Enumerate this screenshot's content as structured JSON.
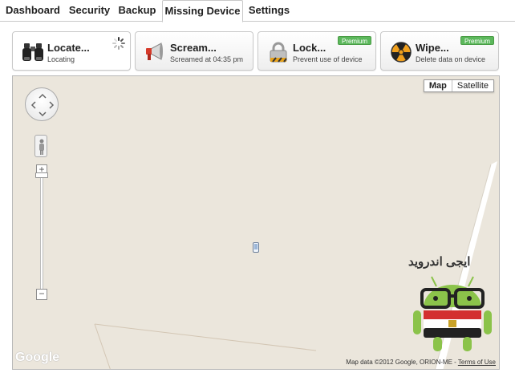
{
  "tabs": [
    {
      "label": "Dashboard",
      "active": false
    },
    {
      "label": "Security",
      "active": false
    },
    {
      "label": "Backup",
      "active": false
    },
    {
      "label": "Missing Device",
      "active": true
    },
    {
      "label": "Settings",
      "active": false
    }
  ],
  "actions": [
    {
      "title": "Locate...",
      "subtitle": "Locating",
      "icon": "binoculars-icon",
      "status": "loading-spinner"
    },
    {
      "title": "Scream...",
      "subtitle": "Screamed at 04:35 pm",
      "icon": "megaphone-icon"
    },
    {
      "title": "Lock...",
      "subtitle": "Prevent use of device",
      "icon": "padlock-icon",
      "badge": "Premium"
    },
    {
      "title": "Wipe...",
      "subtitle": "Delete data on device",
      "icon": "radiation-icon",
      "badge": "Premium"
    }
  ],
  "map": {
    "types": [
      "Map",
      "Satellite"
    ],
    "selected_type": "Map",
    "zoom_in": "+",
    "zoom_out": "−",
    "logo": "Google",
    "attribution": "Map data ©2012 Google, ORION-ME - ",
    "terms_link": "Terms of Use",
    "watermark_text": "ايجى اندرويد"
  },
  "colors": {
    "premium_badge": "#5cb85c",
    "map_land": "#ebe6dc",
    "road": "#ffffff"
  }
}
